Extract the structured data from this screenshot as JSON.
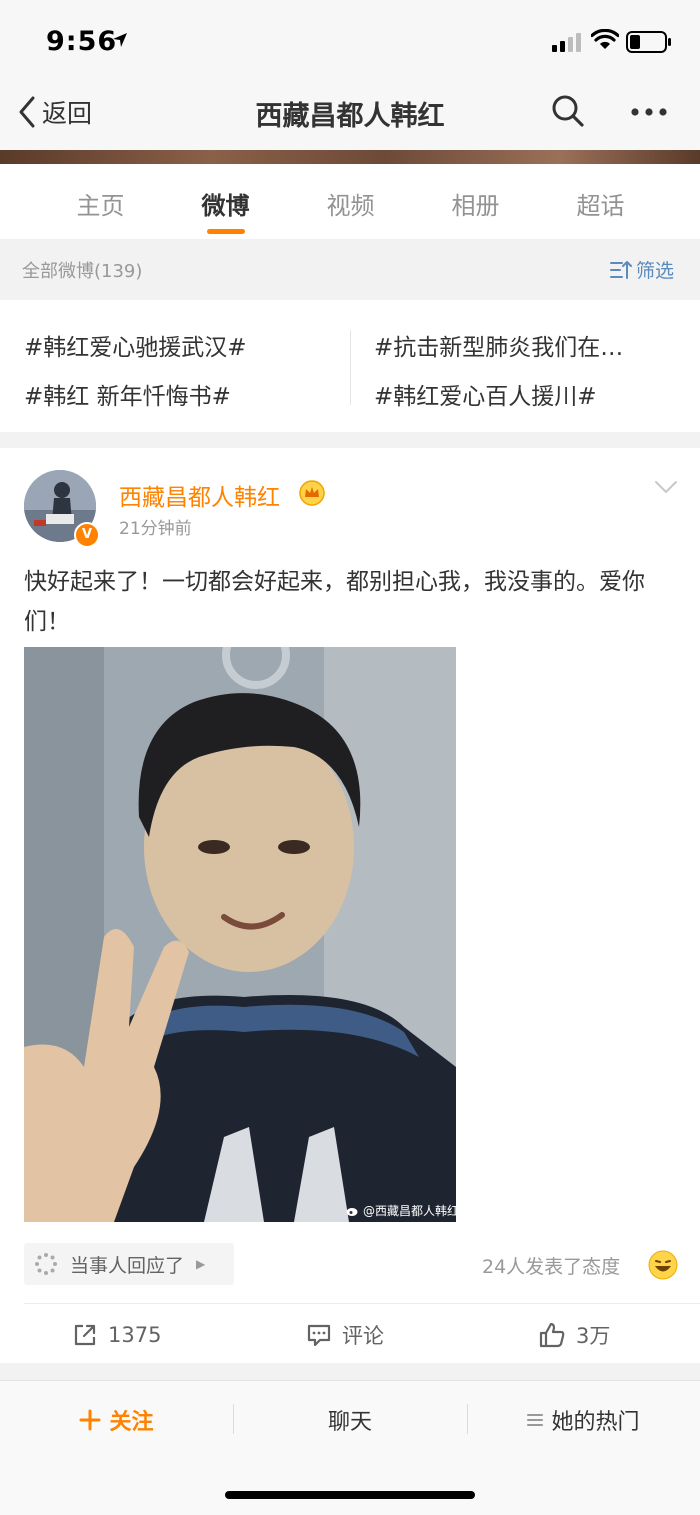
{
  "status_bar": {
    "time": "9:56"
  },
  "nav": {
    "back_label": "返回",
    "title": "西藏昌都人韩红"
  },
  "tabs": [
    {
      "label": "主页"
    },
    {
      "label": "微博"
    },
    {
      "label": "视频"
    },
    {
      "label": "相册"
    },
    {
      "label": "超话"
    }
  ],
  "filter": {
    "count_label": "全部微博(139)",
    "button_label": "筛选"
  },
  "topics": [
    "#韩红爱心驰援武汉#",
    "#抗击新型肺炎我们在…",
    "#韩红 新年忏悔书#",
    "#韩红爱心百人援川#"
  ],
  "post": {
    "author": "西藏昌都人韩红",
    "time": "21分钟前",
    "text": "快好起来了！一切都会好起来，都别担心我，我没事的。爱你们！",
    "watermark": "@西藏昌都人韩红",
    "response_label": "当事人回应了",
    "attitude_label": "24人发表了态度",
    "actions": {
      "share_count": "1375",
      "comment_label": "评论",
      "like_count": "3万"
    }
  },
  "bottom_bar": {
    "follow_label": "关注",
    "chat_label": "聊天",
    "hot_label": "她的热门"
  },
  "colors": {
    "accent": "#ff8200",
    "link_blue": "#5b8bbd"
  }
}
